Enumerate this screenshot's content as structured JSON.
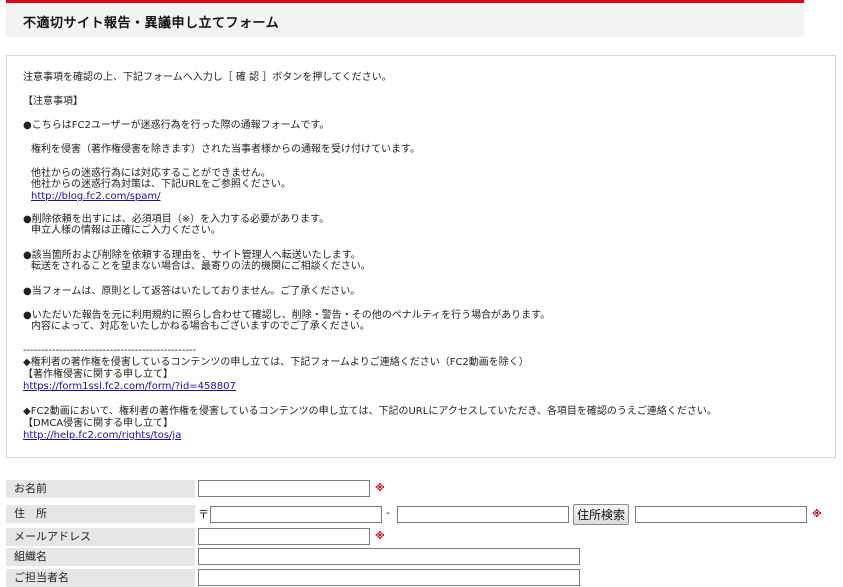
{
  "header": {
    "title": "不適切サイト報告・異議申し立てフォーム"
  },
  "notice": {
    "intro": "注意事項を確認の上、下記フォームへ入力し［ 確 認 ］ボタンを押してください。",
    "section_title": "【注意事項】",
    "bullet1": "●こちらはFC2ユーザーが迷惑行為を行った際の通報フォームです。",
    "bullet1_sub": "権利を侵害（著作権侵害を除きます）された当事者様からの通報を受け付けています。",
    "other_line1": "他社からの迷惑行為には対応することができません。",
    "other_line2": "他社からの迷惑行為対策は、下記URLをご参照ください。",
    "spam_link": "http://blog.fc2.com/spam/",
    "bullet2_line1": "●削除依頼を出すには、必須項目（※）を入力する必要があります。",
    "bullet2_line2": "申立人様の情報は正確にご入力ください。",
    "bullet3_line1": "●該当箇所および削除を依頼する理由を、サイト管理人へ転送いたします。",
    "bullet3_line2": "転送をされることを望まない場合は、最寄りの法的機関にご相談ください。",
    "bullet4": "●当フォームは、原則として返答はいたしておりません。ご了承ください。",
    "bullet5_line1": "●いただいた報告を元に利用規約に照らし合わせて確認し、削除・警告・その他のペナルティを行う場合があります。",
    "bullet5_line2": "内容によって、対応をいたしかねる場合もございますのでご了承ください。",
    "divider": "------------------------------------------------",
    "copyright_line": "◆権利者の著作権を侵害しているコンテンツの申し立ては、下記フォームよりご連絡ください（FC2動画を除く）",
    "copyright_label": "【著作権侵害に関する申し立て】",
    "copyright_link": "https://form1ssl.fc2.com/form/?id=458807",
    "fc2video_line": "◆FC2動画において、権利者の著作権を侵害しているコンテンツの申し立ては、下記のURLにアクセスしていただき、各項目を確認のうえご連絡ください。",
    "dmca_label": "【DMCA侵害に関する申し立て】",
    "dmca_link": "http://help.fc2.com/rights/tos/ja"
  },
  "form": {
    "name_label": "お名前",
    "name_value": "",
    "address_label": "住　所",
    "postal_mark": "〒",
    "postal_dash": "-",
    "postal1_value": "",
    "postal2_value": "",
    "address_search_button": "住所検索",
    "address_value": "",
    "email_label": "メールアドレス",
    "email_value": "",
    "org_label": "組織名",
    "org_value": "",
    "dept_label": "ご担当者名",
    "dept_value": "",
    "required_mark": "※"
  },
  "colors": {
    "accent_red": "#e60012",
    "required_red": "#d4001a",
    "link_blue": "#1a0dab",
    "label_bg": "#e6e6e6"
  }
}
